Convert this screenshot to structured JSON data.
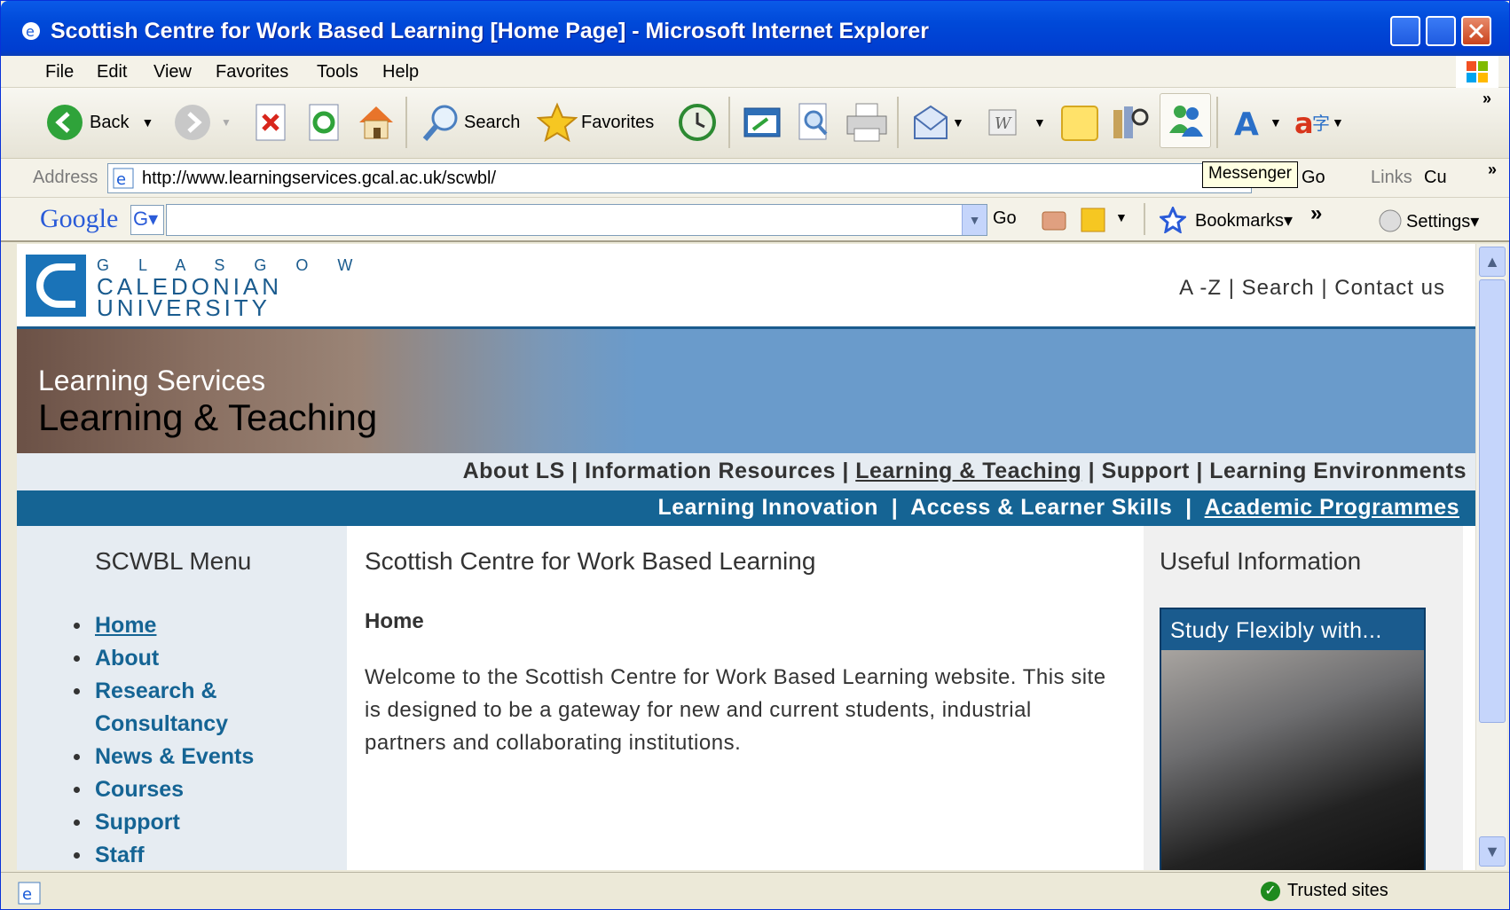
{
  "window": {
    "title": "Scottish Centre for Work Based Learning [Home Page] - Microsoft Internet Explorer",
    "minimize": "_",
    "maximize": "□",
    "close": "✕"
  },
  "menu": {
    "items": [
      "File",
      "Edit",
      "View",
      "Favorites",
      "Tools",
      "Help"
    ]
  },
  "toolbar": {
    "back": "Back",
    "search": "Search",
    "favorites": "Favorites",
    "messenger_tooltip": "Messenger"
  },
  "address": {
    "label": "Address",
    "url": "http://www.learningservices.gcal.ac.uk/scwbl/",
    "go": "Go",
    "links": "Links",
    "links_item": "Cu"
  },
  "googlebar": {
    "logo": "Google",
    "g_button": "G▾",
    "go": "Go",
    "bookmarks": "Bookmarks▾",
    "settings": "Settings▾",
    "more": "»"
  },
  "page": {
    "university_line1": "G L A S G O W",
    "university_line2": "CALEDONIAN",
    "university_line3": "UNIVERSITY",
    "utility_links": "A -Z | Search | Contact us",
    "banner_line1": "Learning Services",
    "banner_line2": "Learning & Teaching",
    "nav_primary": {
      "about": "About LS",
      "info": "Information Resources",
      "lt": "Learning & Teaching",
      "support": "Support",
      "env": "Learning Environments",
      "sep": " | "
    },
    "nav_secondary": {
      "innovation": "Learning Innovation",
      "access": "Access & Learner Skills",
      "academic": "Academic Programmes",
      "sep": "  |  "
    },
    "left_menu_title": "SCWBL Menu",
    "left_menu": {
      "home": "Home",
      "about": "About",
      "research1": "Research &",
      "research2": "Consultancy",
      "news": "News & Events",
      "courses": "Courses",
      "support": "Support",
      "staff": "Staff"
    },
    "main_title": "Scottish Centre for Work Based Learning",
    "main_subtitle": "Home",
    "main_text": "Welcome to the Scottish Centre for Work Based Learning website. This site is designed to be a gateway for new and current students, industrial partners and collaborating institutions.",
    "right_title": "Useful Information",
    "promo_text": "Study Flexibly with..."
  },
  "status": {
    "zone": "Trusted sites"
  }
}
